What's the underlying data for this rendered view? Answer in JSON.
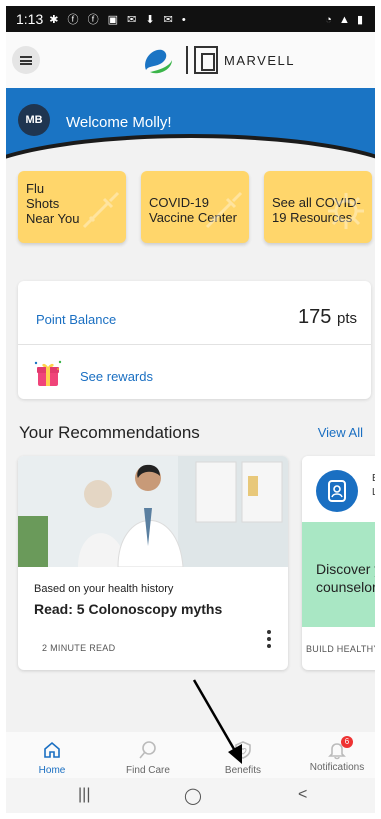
{
  "status_bar": {
    "time": "1:13",
    "icons": "✱ ⓕ ⓕ ▣ ✉ ⬇ ✉ •",
    "right_icons": "◔ ▲ ▮"
  },
  "header": {
    "brand": "MARVELL"
  },
  "welcome": {
    "initials": "MB",
    "text": "Welcome Molly!"
  },
  "tiles": [
    {
      "label": "Flu Shots Near You",
      "lines": [
        "Flu",
        "Shots",
        "Near You"
      ]
    },
    {
      "label": "COVID-19 Vaccine Center",
      "lines": [
        "COVID-19",
        "Vaccine Center"
      ]
    },
    {
      "label": "See all COVID-19 Resources",
      "lines": [
        "See all COVID-",
        "19 Resources"
      ]
    }
  ],
  "points": {
    "label": "Point Balance",
    "value": "175",
    "unit": "pts",
    "rewards_link": "See rewards"
  },
  "recommendations": {
    "title": "Your Recommendations",
    "view_all": "View All",
    "card1": {
      "note": "Based on your health history",
      "headline": "Read: 5 Colonoscopy myths",
      "meta": "2 MINUTE READ"
    },
    "card2": {
      "side_line1": "B",
      "side_line2": "L",
      "text_line1": "Discover y",
      "text_line2": "counselor",
      "meta": "BUILD HEALTHY H"
    }
  },
  "bottom_nav": [
    {
      "label": "Home",
      "icon": "home-icon",
      "active": true
    },
    {
      "label": "Find Care",
      "icon": "search-icon",
      "active": false
    },
    {
      "label": "Benefits",
      "icon": "shield-icon",
      "active": false
    },
    {
      "label": "Notifications",
      "icon": "bell-icon",
      "active": false,
      "badge": "6"
    }
  ],
  "android_nav": {
    "recents": "|||",
    "home": "◯",
    "back": "<"
  },
  "colors": {
    "primary": "#1a74c4",
    "tile": "#ffd66b",
    "link": "#1a6fc2",
    "green_card": "#a9e7c4",
    "badge": "#e33333"
  }
}
